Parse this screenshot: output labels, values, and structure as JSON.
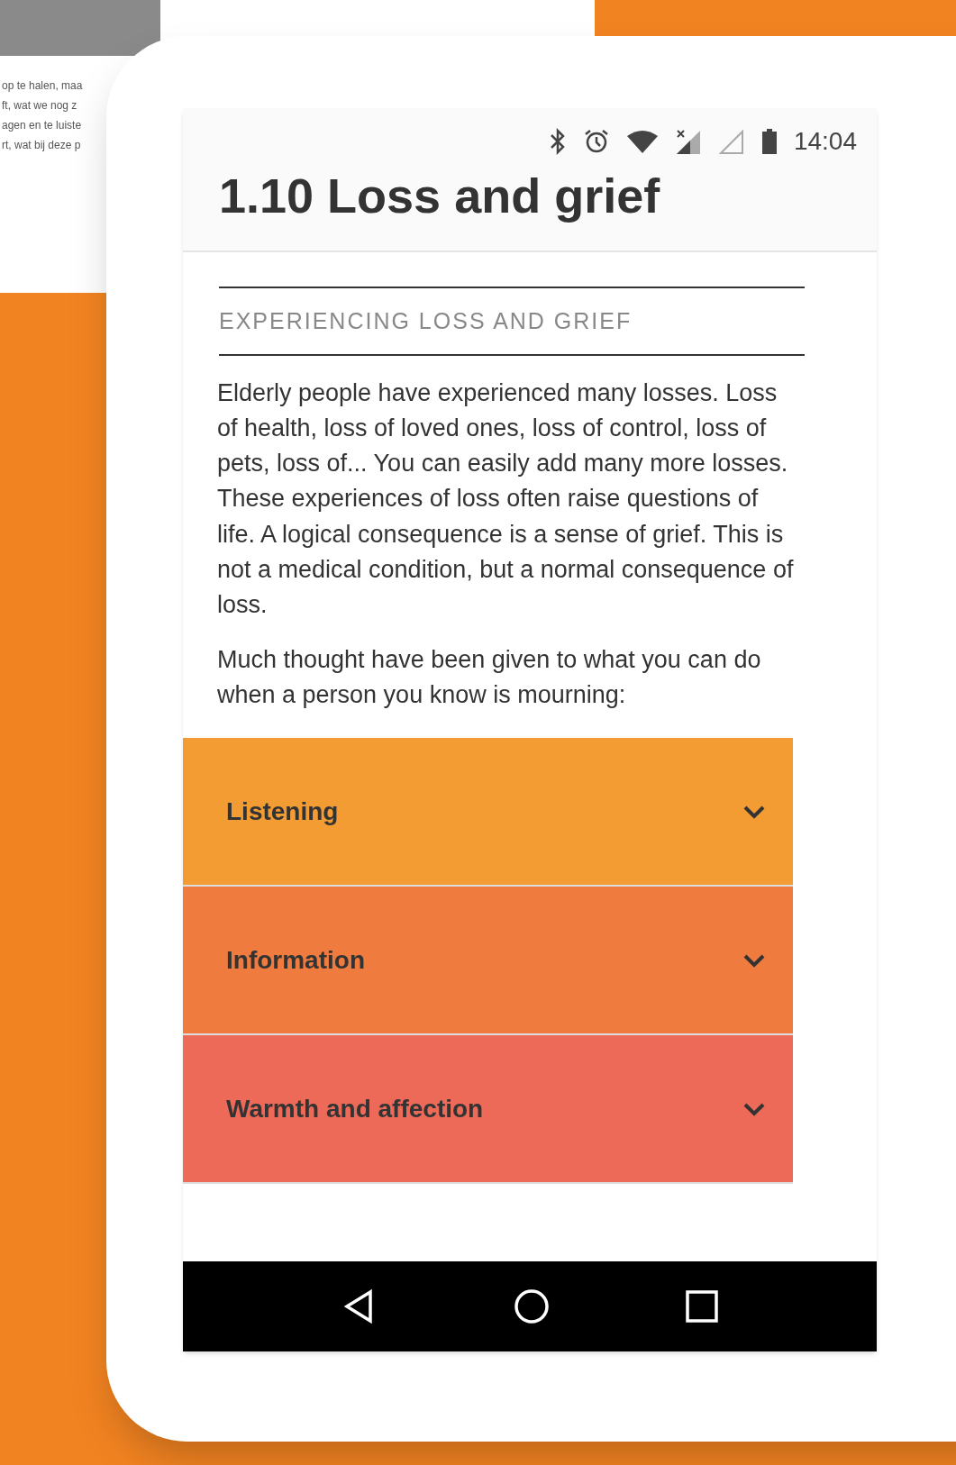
{
  "background_page": {
    "lines": [
      "op te halen, maa",
      "ft, wat we nog z",
      "agen en te luiste",
      "rt, wat bij deze p"
    ]
  },
  "status_bar": {
    "time": "14:04"
  },
  "title": "1.10 Loss and grief",
  "section_heading": "EXPERIENCING LOSS AND GRIEF",
  "paragraphs": [
    "Elderly people have experienced many losses. Loss of health, loss of loved ones, loss of control, loss of pets, loss of... You can easily add many more losses. These experiences of loss often raise questions of life. A logical consequence is a sense of grief. This is not a medical condition, but a normal consequence of loss.",
    "Much thought have been given to what you can do when a person you know is mourning:"
  ],
  "accordion": [
    {
      "label": "Listening",
      "expanded": false,
      "color": "#f39c33"
    },
    {
      "label": "Information",
      "expanded": false,
      "color": "#f07b3f"
    },
    {
      "label": "Warmth and affection",
      "expanded": false,
      "color": "#ee6a58"
    }
  ]
}
